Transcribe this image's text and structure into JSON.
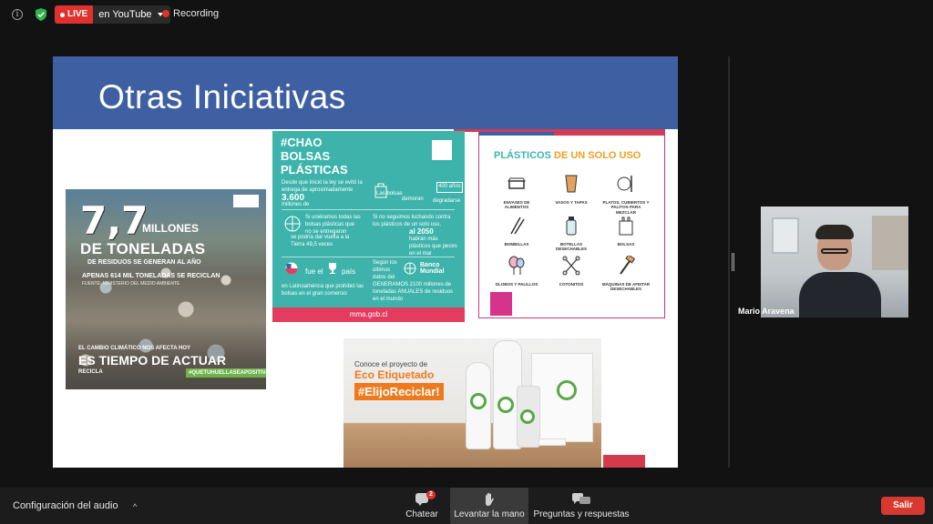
{
  "topbar": {
    "live_label": "LIVE",
    "stream_target": "en YouTube",
    "recording_label": "Recording"
  },
  "slide": {
    "title": "Otras Iniciativas",
    "poster_waste": {
      "big_number": "7,7",
      "millones": "MILLONES",
      "toneladas": "DE TONELADAS",
      "sub1": "DE RESIDUOS SE GENERAN AL AÑO",
      "sub2": "APENAS 614 MIL TONELADAS SE RECICLAN",
      "source": "FUENTE: MINISTERIO DEL MEDIO AMBIENTE",
      "climate": "EL CAMBIO CLIMÁTICO NOS AFECTA HOY",
      "actuar": "ES TIEMPO DE ACTUAR",
      "recicla": "RECICLA",
      "hashtag": "#QUETUHUELLASEAPOSITIVA"
    },
    "poster_teal": {
      "title": "#CHAO BOLSAS PLÁSTICAS",
      "text1": "Desde que inició la ley se evitó la entrega de aproximadamente",
      "stat1": "3.600",
      "stat1_unit": "millones de",
      "text2": "Si uniéramos todas las bolsas plásticas que no se entregaron",
      "text3": "se podría dar vuelta a la Tierra 49,5 veces",
      "text4": "Si no seguimos luchando contra los plásticos de un solo uso,",
      "stat2": "al 2050",
      "text5": "habrán más plásticos que peces en el mar",
      "text6": "fue el",
      "text7": "país",
      "text8": "en Latinoamérica que prohibió las bolsas en el gran comercio",
      "text9": "Según los últimos datos del",
      "bank": "Banco Mundial",
      "text10": "GENERAMOS 2100 millones de toneladas ANUALES de residuos en el mundo",
      "footer": "mma.gob.cl",
      "bag_label": "Las bolsas",
      "demoran": "demoran",
      "years": "400 años",
      "degradarse": "degradarse"
    },
    "poster_plastic": {
      "title_a": "PLÁSTICOS",
      "title_b": "DE UN SOLO USO",
      "items": [
        "ENVASES DE ALIMENTOS",
        "VASOS Y TAPAS",
        "PLATOS, CUBIERTOS Y PALITOS PARA MEZCLAR",
        "BOMBILLAS",
        "BOTELLAS DESECHABLES",
        "BOLSAS",
        "GLOBOS Y PALILLOS",
        "COTONITOS",
        "MÁQUINAS DE AFEITAR DESECHABLES"
      ]
    },
    "poster_eco": {
      "small": "Conoce el proyecto de",
      "title": "Eco Etiquetado",
      "tag": "#ElijoReciclar!"
    }
  },
  "participant": {
    "name": "Mario Aravena"
  },
  "bottombar": {
    "audio_config": "Configuración del audio",
    "chat": "Chatear",
    "chat_badge": "2",
    "raise_hand": "Levantar la mano",
    "qa": "Preguntas y respuestas",
    "leave": "Salir"
  },
  "colors": {
    "slide_header": "#3e60a3",
    "live_red": "#e0312f",
    "teal": "#3db3ab",
    "leave_red": "#d7382f"
  }
}
